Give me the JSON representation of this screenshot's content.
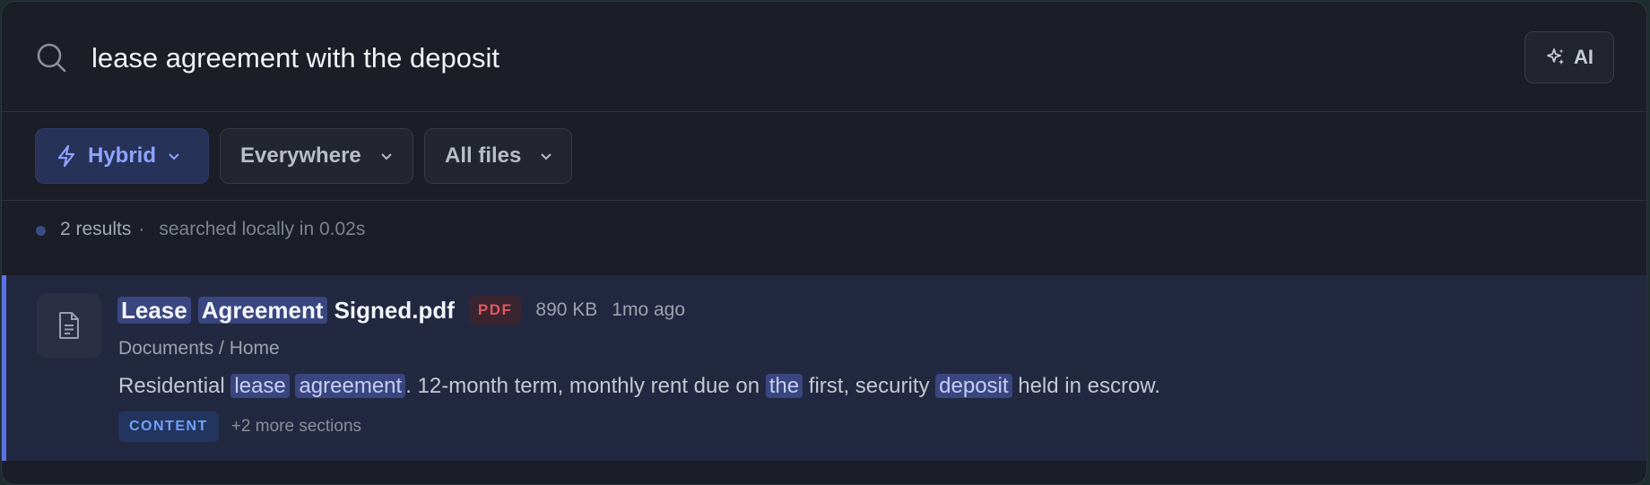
{
  "search": {
    "query": "lease agreement with the deposit",
    "ai_label": "AI"
  },
  "filters": {
    "mode": "Hybrid",
    "scope": "Everywhere",
    "file_type": "All files"
  },
  "status": {
    "count": "2 results",
    "separator": "·",
    "timing": "searched locally in 0.02s"
  },
  "result": {
    "title_hl1": "Lease",
    "title_hl2": "Agreement",
    "title_rest": "Signed.pdf",
    "type_badge": "PDF",
    "size": "890 KB",
    "age": "1mo ago",
    "path": "Documents / Home",
    "snippet": {
      "p1": "Residential",
      "hl1": "lease",
      "hl2": "agreement",
      "p2": ". 12-month term, monthly rent due on",
      "hl3": "the",
      "p3": "first, security",
      "hl4": "deposit",
      "p4": "held in escrow."
    },
    "section_badge": "CONTENT",
    "more_sections": "+2 more sections"
  },
  "colors": {
    "accent": "#5a74e8",
    "mode_text": "#8ea4ff",
    "pdf_badge": "#e0595f",
    "content_badge": "#6fa0ff"
  }
}
